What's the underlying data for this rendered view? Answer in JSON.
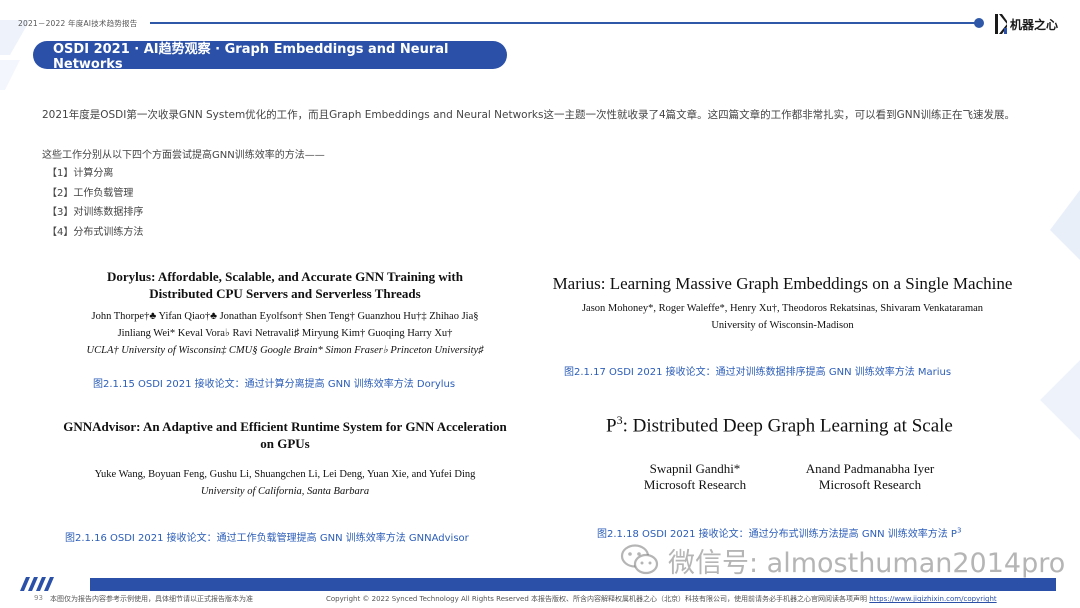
{
  "header": {
    "report_title": "2021－2022 年度AI技术趋势报告",
    "logo_text": "机器之心",
    "section_pill": "OSDI 2021 · AI趋势观察 · Graph Embeddings and Neural Networks"
  },
  "intro": "2021年度是OSDI第一次收录GNN System优化的工作，而且Graph Embeddings and Neural Networks这一主题一次性就收录了4篇文章。这四篇文章的工作都非常扎实，可以看到GNN训练正在飞速发展。",
  "lead": "这些工作分别从以下四个方面尝试提高GNN训练效率的方法——",
  "methods": [
    "【1】计算分离",
    "【2】工作负载管理",
    "【3】对训练数据排序",
    "【4】分布式训练方法"
  ],
  "papers": {
    "dorylus": {
      "title_l1": "Dorylus: Affordable, Scalable, and Accurate GNN Training with",
      "title_l2": "Distributed CPU Servers and Serverless Threads",
      "authors_l1": "John Thorpe†♣    Yifan Qiao†♣    Jonathan Eyolfson†    Shen Teng†    Guanzhou Hu†‡    Zhihao Jia§",
      "authors_l2": "Jinliang Wei*    Keval Vora♭    Ravi Netravali♯    Miryung Kim†    Guoqing Harry Xu†",
      "affiliations": "UCLA†    University of Wisconsin‡    CMU§    Google Brain*    Simon Fraser♭    Princeton University♯",
      "caption": "图2.1.15 OSDI 2021 接收论文：通过计算分离提高 GNN 训练效率方法 Dorylus"
    },
    "gnnadvisor": {
      "title_l1": "GNNAdvisor: An Adaptive and Efficient Runtime System for GNN Acceleration",
      "title_l2": "on GPUs",
      "authors": "Yuke Wang, Boyuan Feng, Gushu Li, Shuangchen Li, Lei Deng, Yuan Xie, and Yufei Ding",
      "affiliation": "University of California, Santa Barbara",
      "caption": "图2.1.16 OSDI 2021 接收论文：通过工作负载管理提高 GNN 训练效率方法 GNNAdvisor"
    },
    "marius": {
      "title": "Marius: Learning Massive Graph Embeddings on a Single Machine",
      "authors": "Jason Mohoney*, Roger Waleffe*, Henry Xu†, Theodoros Rekatsinas, Shivaram Venkataraman",
      "affiliation": "University of Wisconsin-Madison",
      "caption": "图2.1.17 OSDI 2021 接收论文：通过对训练数据排序提高 GNN 训练效率方法 Marius"
    },
    "p3": {
      "title_base": "P",
      "title_sup": "3",
      "title_rest": ": Distributed Deep Graph Learning at Scale",
      "author1": "Swapnil Gandhi*",
      "org1": "Microsoft Research",
      "author2": "Anand Padmanabha Iyer",
      "org2": "Microsoft Research",
      "caption_main": "图2.1.18  OSDI 2021 接收论文：通过分布式训练方法提高 GNN 训练效率方法 P",
      "caption_sup": "3"
    }
  },
  "watermark": "微信号: almosthuman2014pro",
  "footer": {
    "page_number": "93",
    "note": "本图仅为报告内容参考示例使用，具体细节请以正式报告版本为准",
    "copyright": "Copyright © 2022 Synced Technology  All Rights Reserved    本报告版权、所含内容解释权属机器之心（北京）科技有限公司，使用前请务必手机器之心官网阅读各项声明",
    "url": "https://www.jiqizhixin.com/copyright"
  },
  "colors": {
    "brand_blue": "#2b50a8",
    "caption_blue": "#2b5db8"
  }
}
